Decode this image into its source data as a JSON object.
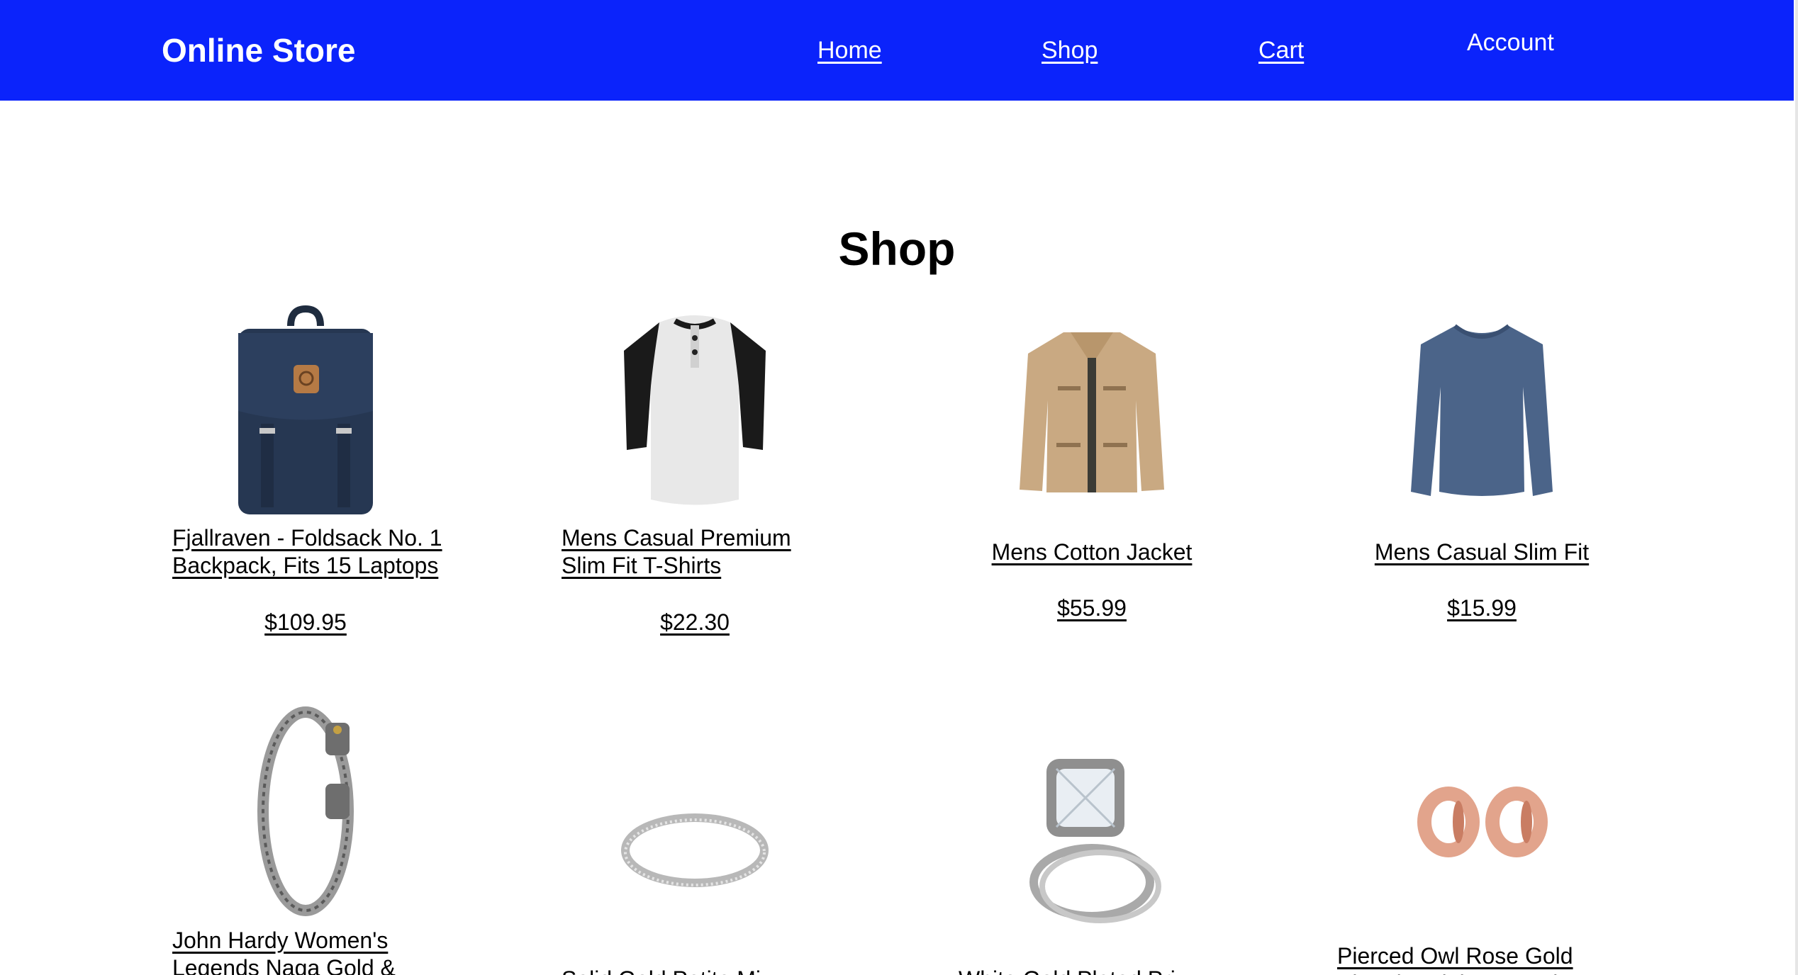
{
  "header": {
    "brand": "Online Store",
    "nav": {
      "home": "Home",
      "shop": "Shop",
      "cart": "Cart",
      "account": "Account"
    },
    "background_color": "#0b23fb"
  },
  "main": {
    "title": "Shop",
    "products": [
      {
        "name": "Fjallraven - Foldsack No. 1 Backpack, Fits 15 Laptops",
        "price": "$109.95",
        "icon": "backpack-image"
      },
      {
        "name": "Mens Casual Premium Slim Fit T-Shirts",
        "price": "$22.30",
        "icon": "tshirt-image"
      },
      {
        "name": "Mens Cotton Jacket",
        "price": "$55.99",
        "icon": "jacket-image"
      },
      {
        "name": "Mens Casual Slim Fit",
        "price": "$15.99",
        "icon": "longsleeve-image"
      },
      {
        "name": "John Hardy Women's Legends Naga Gold &",
        "price": "",
        "icon": "bracelet-image"
      },
      {
        "name": "Solid Gold Petite Mi",
        "price": "",
        "icon": "ring-image"
      },
      {
        "name": "White Gold Plated Pri",
        "price": "",
        "icon": "engagement-ring-image"
      },
      {
        "name": "Pierced Owl Rose Gold Plated Stainless Steel",
        "price": "",
        "icon": "plugs-image"
      }
    ]
  }
}
